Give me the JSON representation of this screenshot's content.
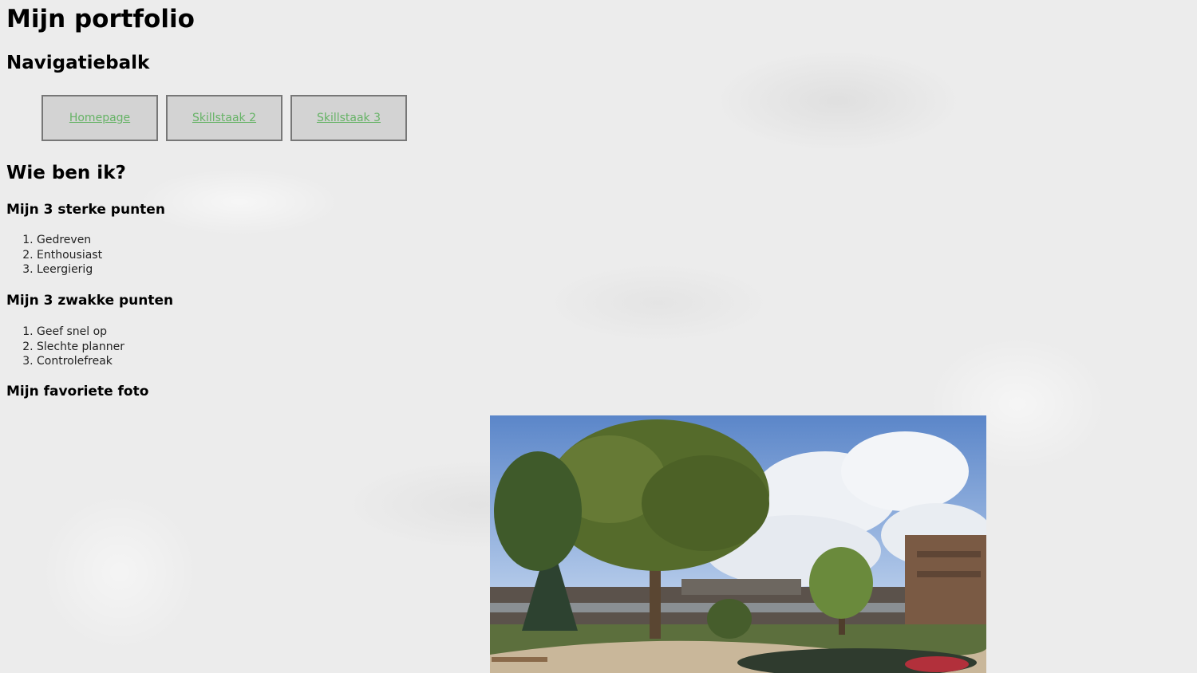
{
  "page": {
    "title": "Mijn portfolio",
    "nav_heading": "Navigatiebalk",
    "about_heading": "Wie ben ik?"
  },
  "nav": {
    "items": [
      {
        "label": "Homepage"
      },
      {
        "label": "Skillstaak 2"
      },
      {
        "label": "Skillstaak 3"
      }
    ]
  },
  "strengths": {
    "heading": "Mijn 3 sterke punten",
    "items": [
      "Gedreven",
      "Enthousiast",
      "Leergierig"
    ]
  },
  "weaknesses": {
    "heading": "Mijn 3 zwakke punten",
    "items": [
      "Geef snel op",
      "Slechte planner",
      "Controlefreak"
    ]
  },
  "photo": {
    "heading": "Mijn favoriete foto",
    "icon": "garden-photo"
  },
  "colors": {
    "link": "#66b366",
    "button_bg": "#d3d3d3",
    "button_border": "#777777"
  }
}
